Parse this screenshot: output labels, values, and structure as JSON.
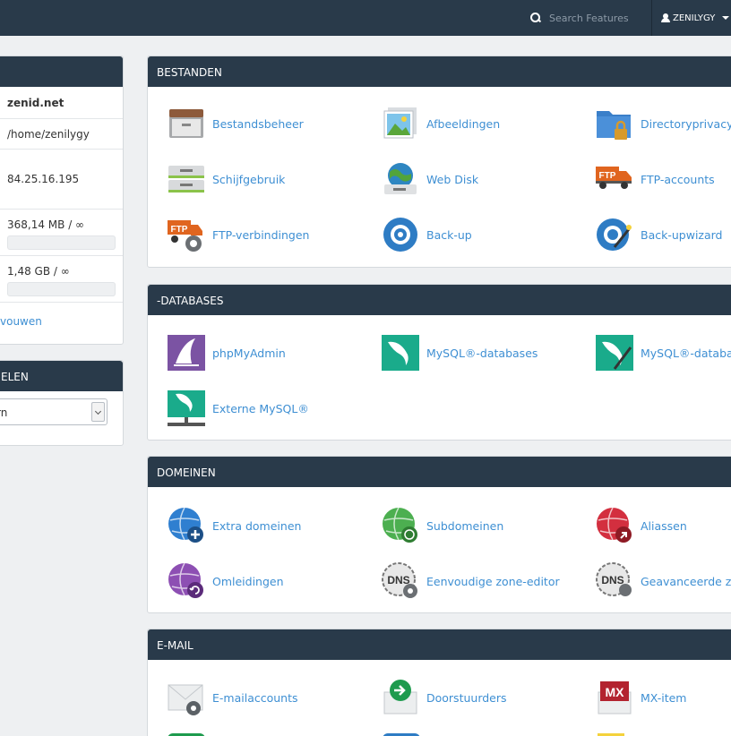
{
  "header": {
    "search_placeholder": "Search Features",
    "username": "ZENILYGY"
  },
  "sidebar": {
    "stats": {
      "domain": "zenid.net",
      "home": "/home/zenilygy",
      "ip": "84.25.16.195",
      "disk": "368,14 MB / ∞",
      "bandwidth": "1,48 GB / ∞",
      "more_link": "vouwen"
    },
    "prefs": {
      "title": "ELEN",
      "select_value": "rn"
    }
  },
  "sections": {
    "files": {
      "title": "BESTANDEN",
      "items": [
        "Bestandsbeheer",
        "Afbeeldingen",
        "Directoryprivacy",
        "Schijfgebruik",
        "Web Disk",
        "FTP-accounts",
        "FTP-verbindingen",
        "Back-up",
        "Back-upwizard"
      ]
    },
    "databases": {
      "title": "-DATABASES",
      "items": [
        "phpMyAdmin",
        "MySQL®-databases",
        "MySQL®-databas",
        "Externe MySQL®"
      ]
    },
    "domains": {
      "title": "DOMEINEN",
      "items": [
        "Extra domeinen",
        "Subdomeinen",
        "Aliassen",
        "Omleidingen",
        "Eenvoudige zone-editor",
        "Geavanceerde zor"
      ]
    },
    "email": {
      "title": "E-MAIL",
      "items": [
        "E-mailaccounts",
        "Doorstuurders",
        "MX-item"
      ]
    }
  },
  "icons": {
    "ftp_text": "FTP",
    "dns_text": "DNS",
    "mx_text": "MX"
  },
  "colors": {
    "topbar": "#293a4a",
    "link": "#3e8fd3",
    "background": "#eef0f2"
  }
}
